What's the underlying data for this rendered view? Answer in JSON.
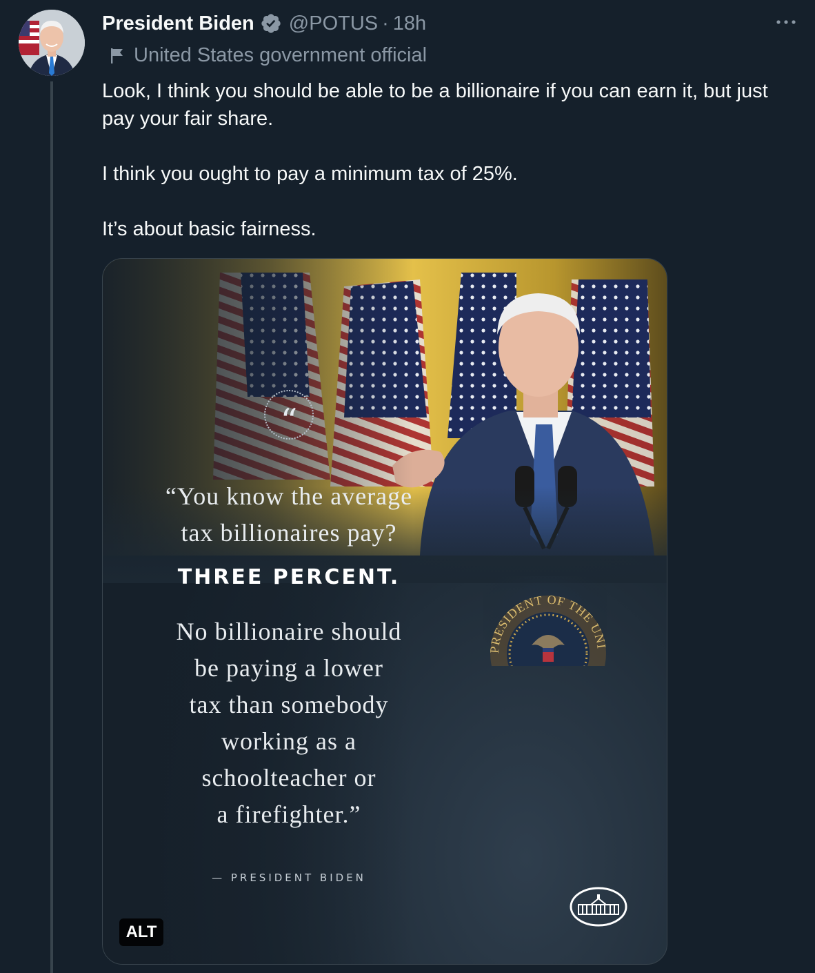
{
  "author": {
    "display_name": "President Biden",
    "handle": "@POTUS",
    "separator": "·",
    "time": "18h",
    "verified": true,
    "avatar_icon": "avatar-photo",
    "affiliation_icon": "flag-icon",
    "affiliation_label": "United States government official"
  },
  "tweet": {
    "paragraphs": [
      "Look, I think you should be able to be a billionaire if you can earn it, but just pay your fair share.",
      "I think you ought to pay a minimum tax of 25%.",
      "It’s about basic fairness."
    ]
  },
  "media": {
    "quote_icon": "“",
    "quote_opening": "“You know the average tax billionaires pay?",
    "quote_opening_line1": "“You know the average",
    "quote_opening_line2": "tax billionaires pay?",
    "quote_emphasis": "THREE PERCENT.",
    "quote_closing_lines": [
      "No billionaire should",
      "be paying a lower",
      "tax than somebody",
      "working as a",
      "schoolteacher or",
      "a firefighter.”"
    ],
    "attribution": "— PRESIDENT BIDEN",
    "seal_text_top": "PRESIDENT OF THE UNITED",
    "seal_text_left": "OF THE",
    "alt_badge": "ALT"
  },
  "colors": {
    "background": "#15202b",
    "text_primary": "#f7f9f9",
    "text_secondary": "#8b98a5",
    "verified_blue": "#8b98a5",
    "border": "#38444d"
  }
}
